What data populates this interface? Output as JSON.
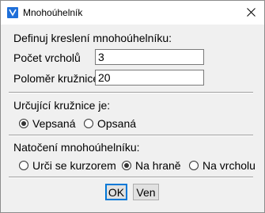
{
  "window": {
    "title": "Mnohoúhelník",
    "icon": "app-icon"
  },
  "definition": {
    "heading": "Definuj kreslení mnohoúhelníku:",
    "vertices_label": "Počet vrcholů",
    "vertices_value": "3",
    "radius_label": "Poloměr kružnice",
    "radius_value": "20"
  },
  "circle": {
    "heading": "Určující kružnice je:",
    "options": [
      {
        "label": "Vepsaná",
        "checked": true
      },
      {
        "label": "Opsaná",
        "checked": false
      }
    ]
  },
  "rotation": {
    "heading": "Natočení mnohoúhelníku:",
    "options": [
      {
        "label": "Urči se kurzorem",
        "checked": false
      },
      {
        "label": "Na hraně",
        "checked": true
      },
      {
        "label": "Na vrcholu",
        "checked": false
      }
    ]
  },
  "buttons": {
    "ok_label": "OK",
    "cancel_label": "Ven"
  },
  "colors": {
    "accent": "#0078d7",
    "icon_blue": "#1e6fd9"
  }
}
